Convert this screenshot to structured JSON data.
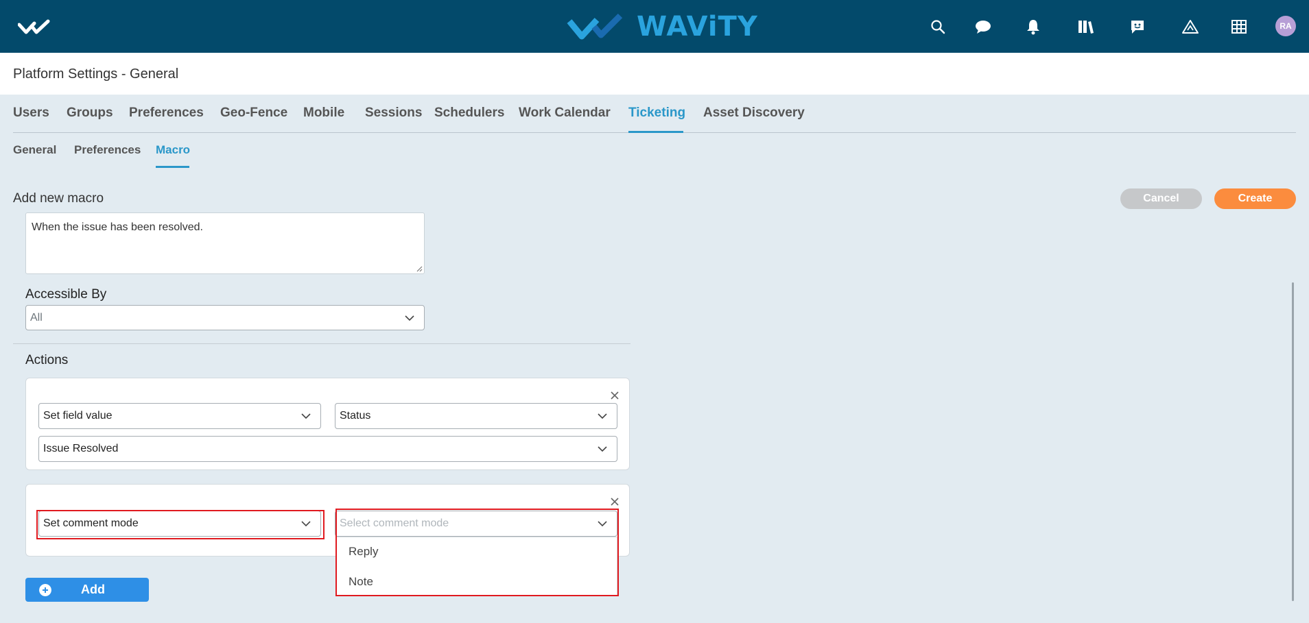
{
  "app": {
    "brand_name": "WAViTY",
    "avatar_initials": "RA",
    "brand_colors": {
      "topbar": "#034a6b",
      "accent": "#2a97c9",
      "create": "#fb8c3e",
      "add": "#2e8fe6",
      "highlight": "#e0191f"
    },
    "top_icons": [
      "search-icon",
      "chat-icon",
      "bell-icon",
      "library-icon",
      "feedback-icon",
      "alert-triangle-icon",
      "grid-apps-icon"
    ]
  },
  "page": {
    "title": "Platform Settings - General"
  },
  "tabs": {
    "items": [
      "Users",
      "Groups",
      "Preferences",
      "Geo-Fence",
      "Mobile",
      "Sessions",
      "Schedulers",
      "Work Calendar",
      "Ticketing",
      "Asset Discovery"
    ],
    "active": "Ticketing"
  },
  "subtabs": {
    "items": [
      "General",
      "Preferences",
      "Macro"
    ],
    "active": "Macro"
  },
  "form": {
    "section_title": "Add new macro",
    "cancel_label": "Cancel",
    "create_label": "Create",
    "description_value": "When the issue has been resolved.",
    "accessible_by_label": "Accessible By",
    "accessible_by_value": "All",
    "actions_label": "Actions",
    "action1": {
      "type": "Set field value",
      "field": "Status",
      "value": "Issue Resolved"
    },
    "action2": {
      "type": "Set comment mode",
      "mode_placeholder": "Select comment mode"
    },
    "comment_mode_options": [
      "Reply",
      "Note"
    ],
    "add_label": "Add"
  }
}
